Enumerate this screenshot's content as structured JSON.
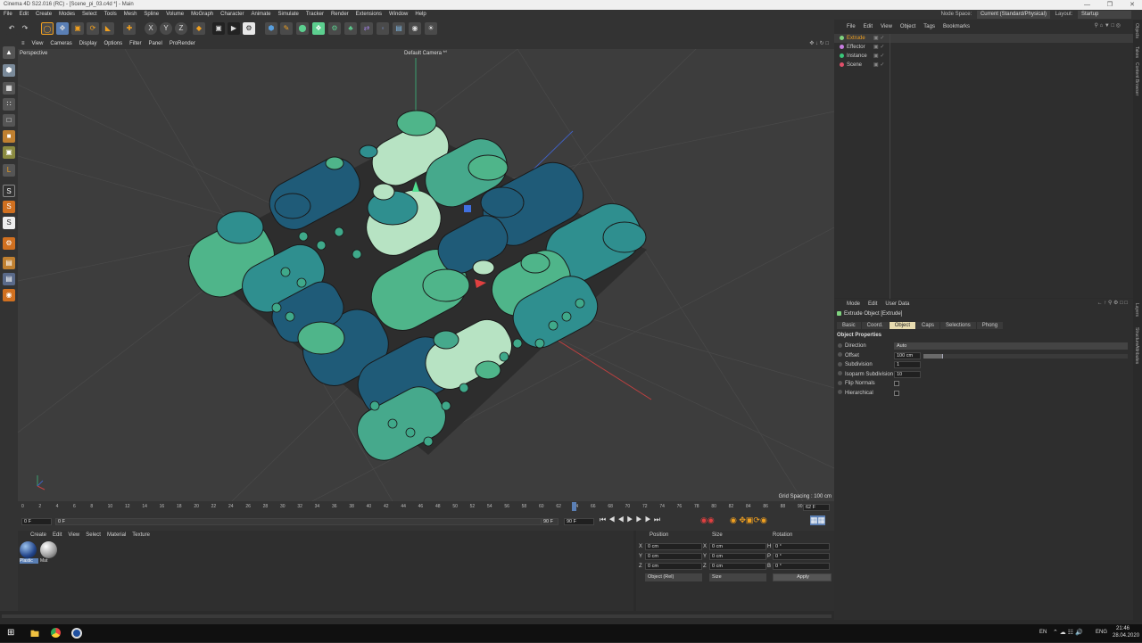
{
  "window": {
    "title": "Cinema 4D S22.016 (RC) - [Scene_pi_03.c4d *] - Main"
  },
  "menubar": {
    "items": [
      "File",
      "Edit",
      "Create",
      "Modes",
      "Select",
      "Tools",
      "Mesh",
      "Spline",
      "Volume",
      "MoGraph",
      "Character",
      "Animate",
      "Simulate",
      "Tracker",
      "Render",
      "Extensions",
      "Window",
      "Help"
    ],
    "node_space_label": "Node Space:",
    "node_space_value": "Current (Standard/Physical)",
    "layout_label": "Layout:",
    "layout_value": "Startup"
  },
  "viewport": {
    "menu": [
      "View",
      "Cameras",
      "Display",
      "Options",
      "Filter",
      "Panel",
      "ProRender"
    ],
    "projection": "Perspective",
    "camera": "Default Camera *°",
    "grid_spacing": "Grid Spacing : 100 cm"
  },
  "timeline": {
    "ticks": [
      "0",
      "2",
      "4",
      "6",
      "8",
      "10",
      "12",
      "14",
      "16",
      "18",
      "20",
      "22",
      "24",
      "26",
      "28",
      "30",
      "32",
      "34",
      "36",
      "38",
      "40",
      "42",
      "44",
      "46",
      "48",
      "50",
      "52",
      "54",
      "56",
      "58",
      "60",
      "62",
      "64",
      "66",
      "68",
      "70",
      "72",
      "74",
      "76",
      "78",
      "80",
      "82",
      "84",
      "86",
      "88",
      "90"
    ],
    "current_frame": "62 F",
    "start_frame": "0 F",
    "min_frame": "0 F",
    "end_frame": "90 F",
    "max_frame": "90 F",
    "playhead": 62
  },
  "material_manager": {
    "menu": [
      "Create",
      "Edit",
      "View",
      "Select",
      "Material",
      "Texture"
    ],
    "materials": [
      "Plastic",
      "Mat"
    ]
  },
  "coord_manager": {
    "headers": [
      "Position",
      "Size",
      "Rotation"
    ],
    "rows": [
      {
        "axis": "X",
        "pos": "0 cm",
        "size_axis": "X",
        "size": "0 cm",
        "rot_axis": "H",
        "rot": "0 °"
      },
      {
        "axis": "Y",
        "pos": "0 cm",
        "size_axis": "Y",
        "size": "0 cm",
        "rot_axis": "P",
        "rot": "0 °"
      },
      {
        "axis": "Z",
        "pos": "0 cm",
        "size_axis": "Z",
        "size": "0 cm",
        "rot_axis": "B",
        "rot": "0 °"
      }
    ],
    "mode": "Object (Rel)",
    "size_mode": "Size",
    "apply": "Apply"
  },
  "object_manager": {
    "menu": [
      "File",
      "Edit",
      "View",
      "Object",
      "Tags",
      "Bookmarks"
    ],
    "objects": [
      {
        "name": "Extrude",
        "color": "#7fd37f",
        "selected": true
      },
      {
        "name": "Effector",
        "color": "#c77de0"
      },
      {
        "name": "Instance",
        "color": "#39c77a"
      },
      {
        "name": "Scene",
        "color": "#e0506a"
      }
    ]
  },
  "attribute_manager": {
    "menu": [
      "Mode",
      "Edit",
      "User Data"
    ],
    "object_title": "Extrude Object [Extrude]",
    "tabs": [
      "Basic",
      "Coord.",
      "Object",
      "Caps",
      "Selections",
      "Phong"
    ],
    "active_tab": "Object",
    "section": "Object Properties",
    "props": [
      {
        "label": "Direction",
        "value": "Auto"
      },
      {
        "label": "Offset",
        "value": "100 cm"
      },
      {
        "label": "Subdivision",
        "value": "1"
      },
      {
        "label": "Isoparm Subdivision",
        "value": "10"
      },
      {
        "label": "Flip Normals",
        "value": ""
      },
      {
        "label": "Hierarchical",
        "value": ""
      }
    ]
  },
  "right_strip": [
    "Objects",
    "Takes",
    "Content Browser",
    "Layers",
    "Structure",
    "Attributes"
  ],
  "taskbar": {
    "lang1": "EN",
    "lang2": "ENG",
    "time": "21:46",
    "date": "28.04.2020"
  },
  "colors": {
    "panel": "#333333",
    "viewport": "#3d3d3d",
    "accent": "#f0a020",
    "selected_tab": "#e8dcb0"
  }
}
